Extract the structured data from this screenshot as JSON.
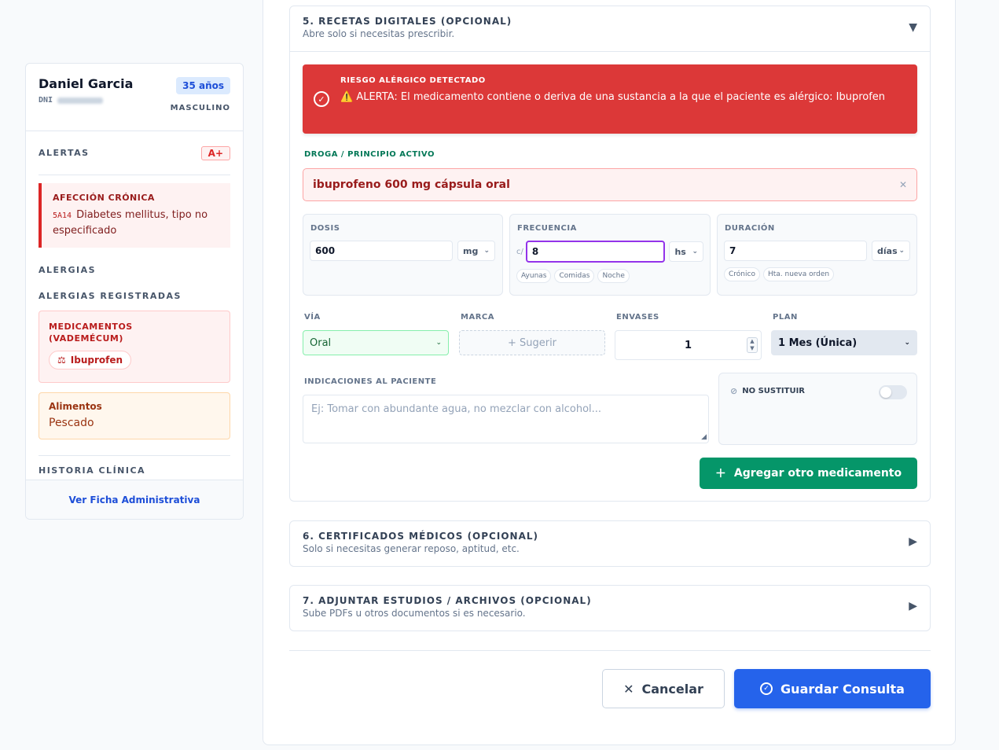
{
  "patient": {
    "name": "Daniel Garcia",
    "dni_label": "DNI",
    "age": "35 años",
    "sex": "MASCULINO"
  },
  "sidebar": {
    "alerts_title": "ALERTAS",
    "blood_type": "A+",
    "chronic_title": "AFECCIÓN CRÓNICA",
    "chronic_code": "5A14",
    "chronic_text": "Diabetes mellitus, tipo no especificado",
    "allergies_title": "ALERGIAS",
    "registered_title": "ALERGIAS REGISTRADAS",
    "med_title": "MEDICAMENTOS (VADEMÉCUM)",
    "med_allergy": "Ibuprofen",
    "food_title": "Alimentos",
    "food_value": "Pescado",
    "history_title": "HISTORIA CLÍNICA",
    "admin_link": "Ver Ficha Administrativa"
  },
  "section5": {
    "title": "5. RECETAS DIGITALES (OPCIONAL)",
    "subtitle": "Abre solo si necesitas prescribir.",
    "arrow": "▼",
    "alert_title": "RIESGO ALÉRGICO DETECTADO",
    "alert_text": "⚠️ ALERTA: El medicamento contiene o deriva de una sustancia a la que el paciente es alérgico: Ibuprofen",
    "drug_label": "DROGA / PRINCIPIO ACTIVO",
    "drug_value": "ibuprofeno 600 mg cápsula oral",
    "dose_label": "DOSIS",
    "dose_value": "600",
    "dose_unit": "mg",
    "freq_label": "FRECUENCIA",
    "freq_prefix": "c/",
    "freq_value": "8",
    "freq_unit": "hs",
    "freq_chips": [
      "Ayunas",
      "Comidas",
      "Noche"
    ],
    "dur_label": "DURACIÓN",
    "dur_value": "7",
    "dur_unit": "días",
    "dur_chips": [
      "Crónico",
      "Hta. nueva orden"
    ],
    "via_label": "VÍA",
    "via_value": "Oral",
    "brand_label": "MARCA",
    "brand_button": "+ Sugerir",
    "packs_label": "ENVASES",
    "packs_value": "1",
    "plan_label": "PLAN",
    "plan_value": "1 Mes (Única)",
    "instructions_label": "INDICACIONES AL PACIENTE",
    "instructions_placeholder": "Ej: Tomar con abundante agua, no mezclar con alcohol...",
    "no_sub_label": "NO SUSTITUIR",
    "add_button": "Agregar otro medicamento"
  },
  "section6": {
    "title": "6. CERTIFICADOS MÉDICOS (OPCIONAL)",
    "subtitle": "Solo si necesitas generar reposo, aptitud, etc.",
    "arrow": "▶"
  },
  "section7": {
    "title": "7. ADJUNTAR ESTUDIOS / ARCHIVOS (OPCIONAL)",
    "subtitle": "Sube PDFs u otros documentos si es necesario.",
    "arrow": "▶"
  },
  "actions": {
    "cancel": "Cancelar",
    "save": "Guardar Consulta"
  },
  "colors": {
    "primary": "#2563eb",
    "danger": "#dc3838",
    "success": "#059669"
  }
}
